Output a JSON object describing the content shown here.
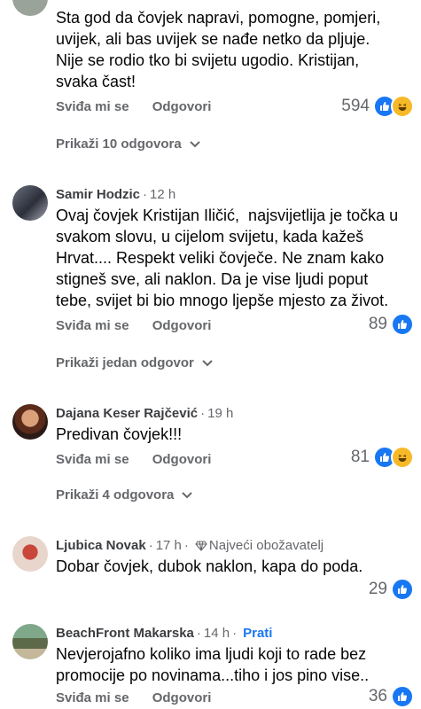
{
  "actions": {
    "like": "Sviđa mi se",
    "reply": "Odgovori"
  },
  "colors": {
    "like_blue": "#1877f2",
    "haha_yellow": "#f7b928",
    "meta_gray": "#65676b"
  },
  "comments": [
    {
      "author": "",
      "time": "",
      "body": "Sta god da čovjek napravi, pomogne, pomjeri,\nuvijek, ali bas uvijek se nađe netko da pljuje.\nNije se rodio tko bi svijetu ugodio. Kristijan,\nsvaka čast!",
      "reactions": "594",
      "reaction_icons": [
        "like-icon",
        "haha-icon"
      ],
      "replies": "Prikaži 10 odgovora"
    },
    {
      "author": "Samir Hodzic",
      "time": "12 h",
      "body": "Ovaj čovjek Kristijan Iličić,  najsvijetlija je točka u\nsvakom slovu, u cijelom svijetu, kada kažeš\nHrvat.... Respekt veliki čovječe. Ne znam kako\nstigneš sve, ali naklon. Da je vise ljudi poput\ntebe, svijet bi bio mnogo ljepše mjesto za život.",
      "reactions": "89",
      "reaction_icons": [
        "like-icon"
      ],
      "replies": "Prikaži jedan odgovor"
    },
    {
      "author": "Dajana Keser Rajčević",
      "time": "19 h",
      "body": "Predivan čovjek!!!",
      "reactions": "81",
      "reaction_icons": [
        "like-icon",
        "haha-icon"
      ],
      "replies": "Prikaži 4 odgovora"
    },
    {
      "author": "Ljubica Novak",
      "time": "17 h",
      "badge": "Najveći obožavatelj",
      "body": "Dobar čovjek, dubok naklon, kapa do poda.",
      "reactions": "29",
      "reaction_icons": [
        "like-icon"
      ]
    },
    {
      "author": "BeachFront Makarska",
      "time": "14 h",
      "follow": "Prati",
      "body": "Nevjerojafno koliko ima ljudi koji to rade bez\npromocije po novinama...tiho i jos pino vise..",
      "reactions": "36",
      "reaction_icons": [
        "like-icon"
      ]
    }
  ]
}
